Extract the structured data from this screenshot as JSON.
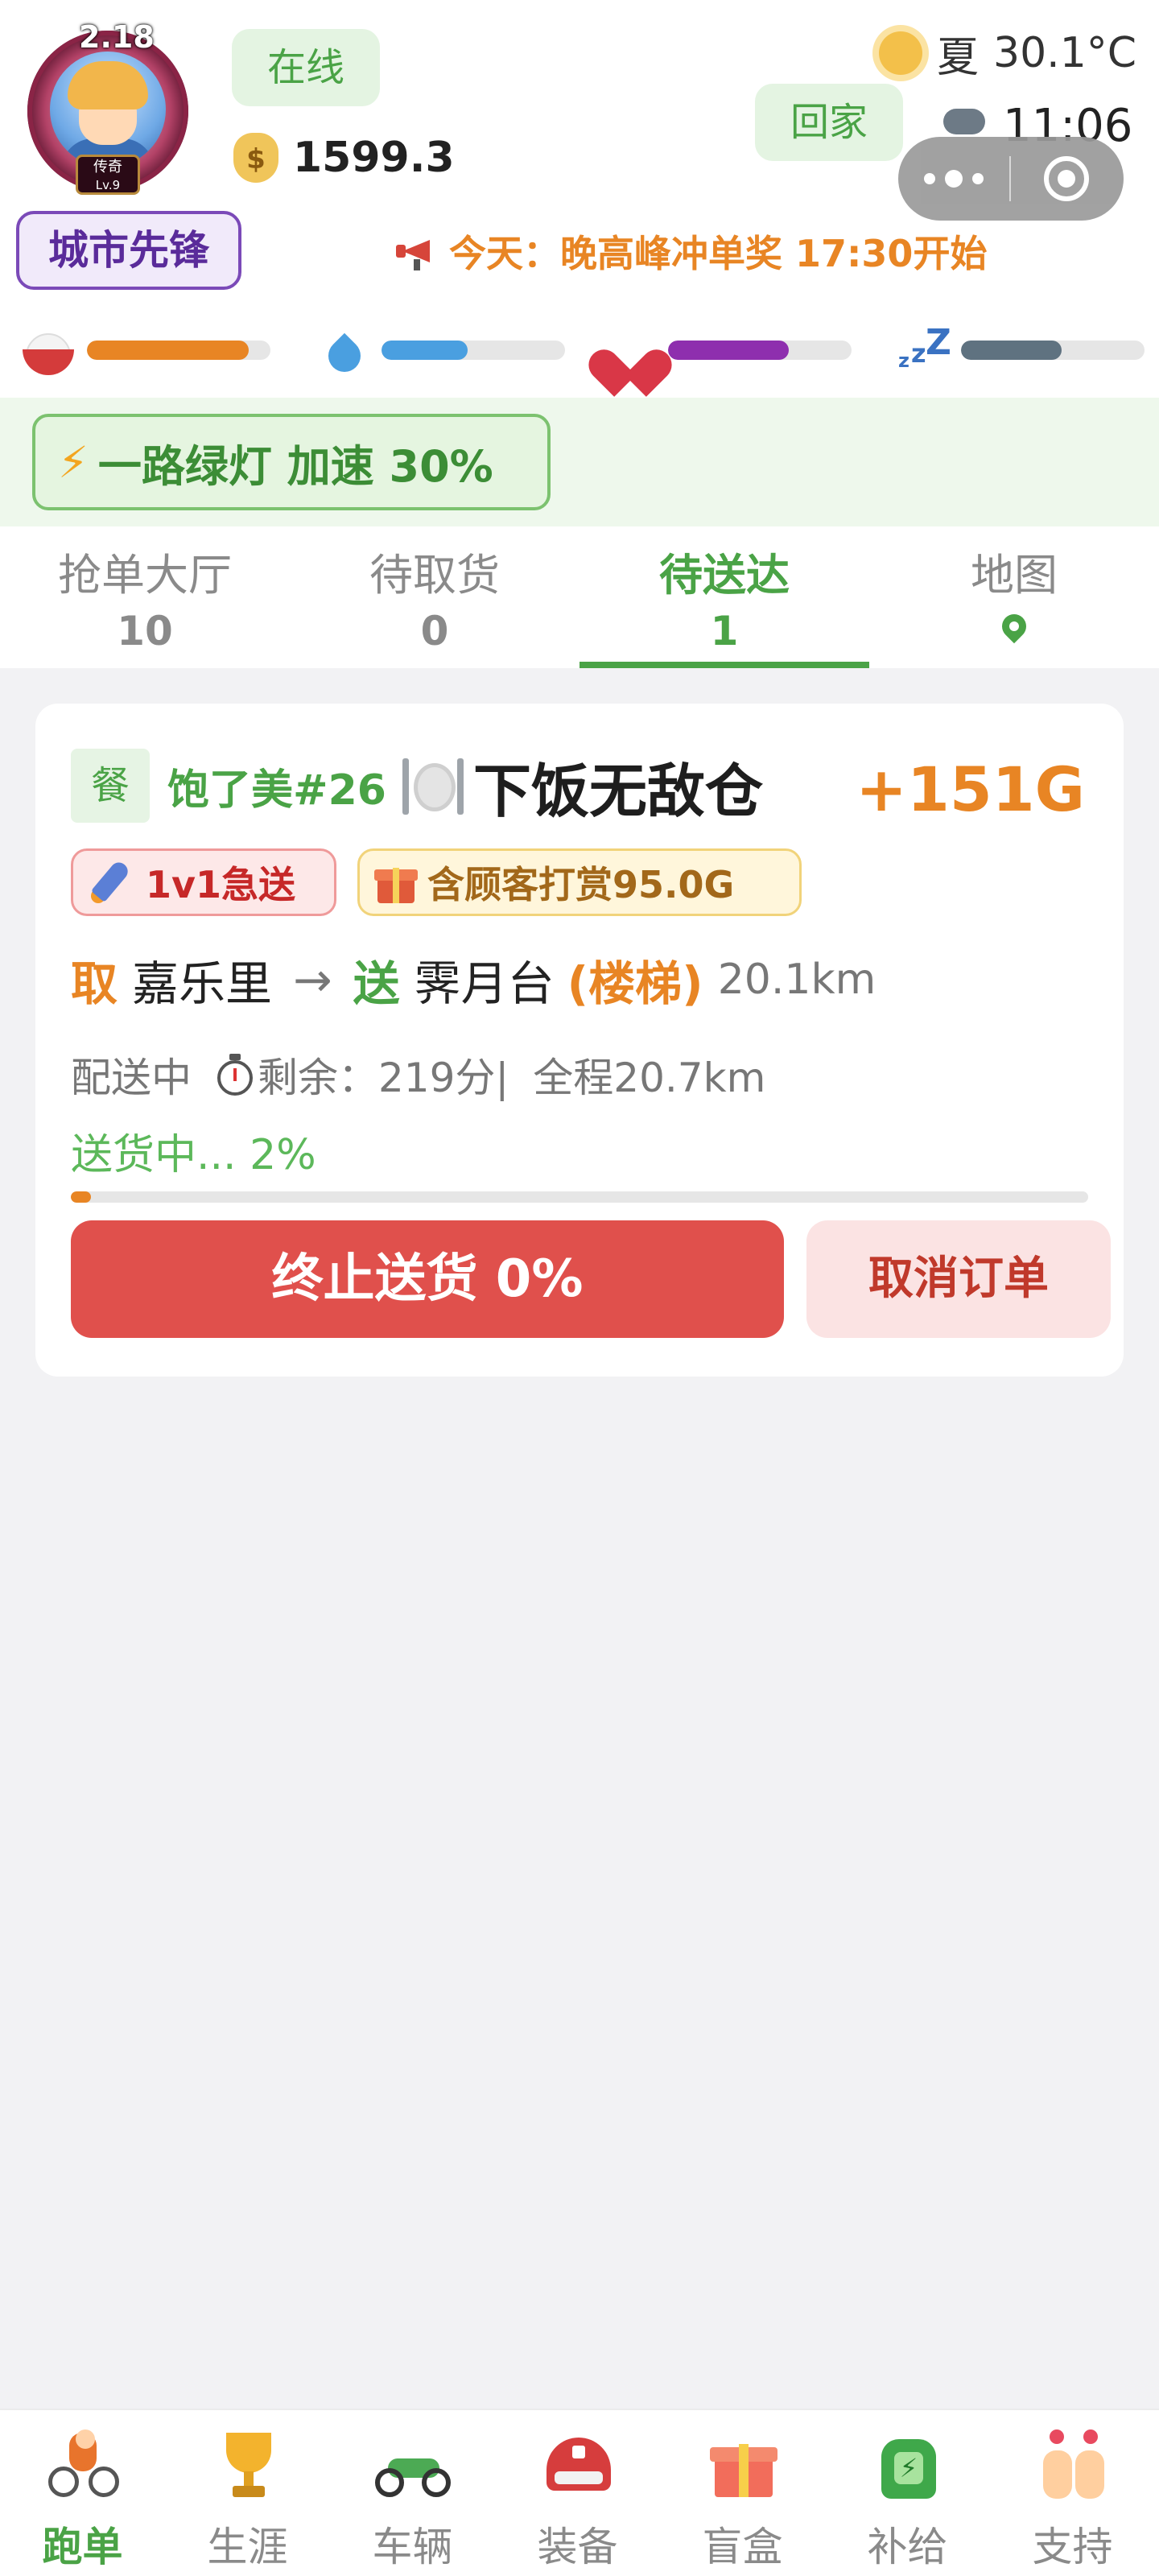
{
  "header": {
    "avatar": {
      "level": "2.18",
      "rank": "传奇",
      "rank_level": "Lv.9"
    },
    "status": "在线",
    "coins": "1599.3",
    "coin_icon": "money-bag-icon",
    "weather": {
      "icon": "sun-icon",
      "season": "夏",
      "temperature": "30.1°C"
    },
    "go_home": "回家",
    "time": {
      "icon": "cloud-icon",
      "value": "11:06"
    },
    "title_badge": "城市先锋",
    "announcement": "今天：晚高峰冲单奖 17:30开始",
    "stats": [
      {
        "name": "hunger",
        "icon": "rice-bowl-icon",
        "value": 0.88,
        "color": "#e88524"
      },
      {
        "name": "thirst",
        "icon": "water-drop-icon",
        "value": 0.47,
        "color": "#4a9fe0"
      },
      {
        "name": "health",
        "icon": "heart-icon",
        "value": 0.66,
        "color": "#8e2fae"
      },
      {
        "name": "sleep",
        "icon": "sleep-zzz-icon",
        "value": 0.55,
        "color": "#5f7280"
      }
    ],
    "boost": "一路绿灯 加速 30%"
  },
  "tabs": [
    {
      "label": "抢单大厅",
      "count": "10",
      "active": false
    },
    {
      "label": "待取货",
      "count": "0",
      "active": false
    },
    {
      "label": "待送达",
      "count": "1",
      "active": true
    },
    {
      "label": "地图",
      "icon": "map-pin-icon",
      "active": false
    }
  ],
  "order": {
    "category": "餐",
    "store": "饱了美#26",
    "dish_icon": "plate-fork-knife-icon",
    "dish": "下饭无敌仓",
    "reward": "+151G",
    "chips": {
      "urgent": "1v1急送",
      "tip": "含顾客打赏95.0G"
    },
    "route": {
      "pickup_label": "取",
      "pickup": "嘉乐里",
      "arrow": "→",
      "dropoff_label": "送",
      "dropoff": "霁月台",
      "stairs": "(楼梯)",
      "distance": "20.1km"
    },
    "status": "配送中",
    "remaining": "剩余：219分|",
    "total": "全程20.7km",
    "progress_text": "送货中... 2%",
    "progress": 0.02,
    "stop_button": "终止送货 0%",
    "cancel_button": "取消订单"
  },
  "nav": [
    {
      "label": "跑单",
      "icon": "cyclist-icon",
      "active": true
    },
    {
      "label": "生涯",
      "icon": "trophy-icon",
      "active": false
    },
    {
      "label": "车辆",
      "icon": "motorcycle-icon",
      "active": false
    },
    {
      "label": "装备",
      "icon": "helmet-icon",
      "active": false
    },
    {
      "label": "盲盒",
      "icon": "gift-box-icon",
      "active": false
    },
    {
      "label": "补给",
      "icon": "backpack-icon",
      "active": false
    },
    {
      "label": "支持",
      "icon": "heart-hands-icon",
      "active": false
    }
  ],
  "colors": {
    "accent_green": "#4aa346",
    "accent_orange": "#e88524",
    "danger_red": "#e0504c"
  }
}
